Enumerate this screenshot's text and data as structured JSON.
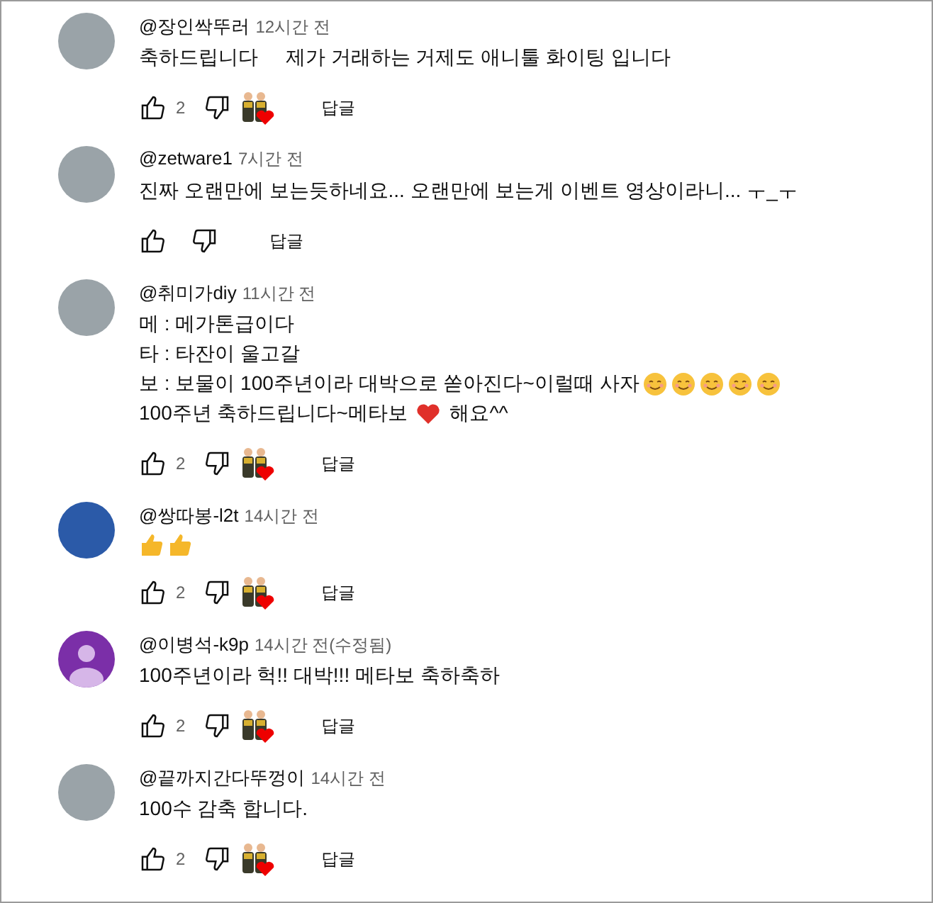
{
  "comments": [
    {
      "author": "@장인싹뚜러",
      "time": "12시간 전",
      "avatar": {
        "kind": "photo"
      },
      "lines": [
        [
          {
            "kind": "text",
            "text": "축하드립니다     제가 거래하는 거제도 애니툴 화이팅 입니다"
          }
        ]
      ],
      "likes": "2",
      "hearted": true,
      "reply": "답글"
    },
    {
      "author": "@zetware1",
      "time": "7시간 전",
      "avatar": {
        "kind": "photo"
      },
      "lines": [
        [
          {
            "kind": "text",
            "text": "진짜 오랜만에 보는듯하네요... 오랜만에 보는게 이벤트 영상이라니... ㅜ_ㅜ"
          }
        ]
      ],
      "hearted": false,
      "reply": "답글"
    },
    {
      "author": "@취미가diy",
      "time": "11시간 전",
      "avatar": {
        "kind": "photo"
      },
      "lines": [
        [
          {
            "kind": "text",
            "text": "메 : 메가톤급이다"
          }
        ],
        [
          {
            "kind": "text",
            "text": "타 : 타잔이 울고갈"
          }
        ],
        [
          {
            "kind": "text",
            "text": "보 : 보물이 100주년이라 대박으로 쏟아진다~이럴때 사자"
          },
          {
            "kind": "smile"
          },
          {
            "kind": "smile"
          },
          {
            "kind": "smile"
          },
          {
            "kind": "smile"
          },
          {
            "kind": "smile"
          }
        ],
        [
          {
            "kind": "text",
            "text": "100주년 축하드립니다~메타보 "
          },
          {
            "kind": "heart"
          },
          {
            "kind": "text",
            "text": " 해요^^"
          }
        ]
      ],
      "likes": "2",
      "hearted": true,
      "reply": "답글"
    },
    {
      "author": "@쌍따봉-l2t",
      "time": "14시간 전",
      "avatar": {
        "kind": "character"
      },
      "lines": [
        [
          {
            "kind": "thumbs"
          },
          {
            "kind": "thumbs"
          }
        ]
      ],
      "likes": "2",
      "hearted": true,
      "reply": "답글"
    },
    {
      "author": "@이병석-k9p",
      "time": "14시간 전(수정됨)",
      "avatar": {
        "kind": "default"
      },
      "lines": [
        [
          {
            "kind": "text",
            "text": "100주년이라 헉!! 대박!!! 메타보 축하축하"
          }
        ]
      ],
      "likes": "2",
      "hearted": true,
      "reply": "답글"
    },
    {
      "author": "@끝까지간다뚜껑이",
      "time": "14시간 전",
      "avatar": {
        "kind": "photo"
      },
      "lines": [
        [
          {
            "kind": "text",
            "text": "100수 감축 합니다."
          }
        ]
      ],
      "likes": "2",
      "hearted": true,
      "reply": "답글"
    }
  ]
}
